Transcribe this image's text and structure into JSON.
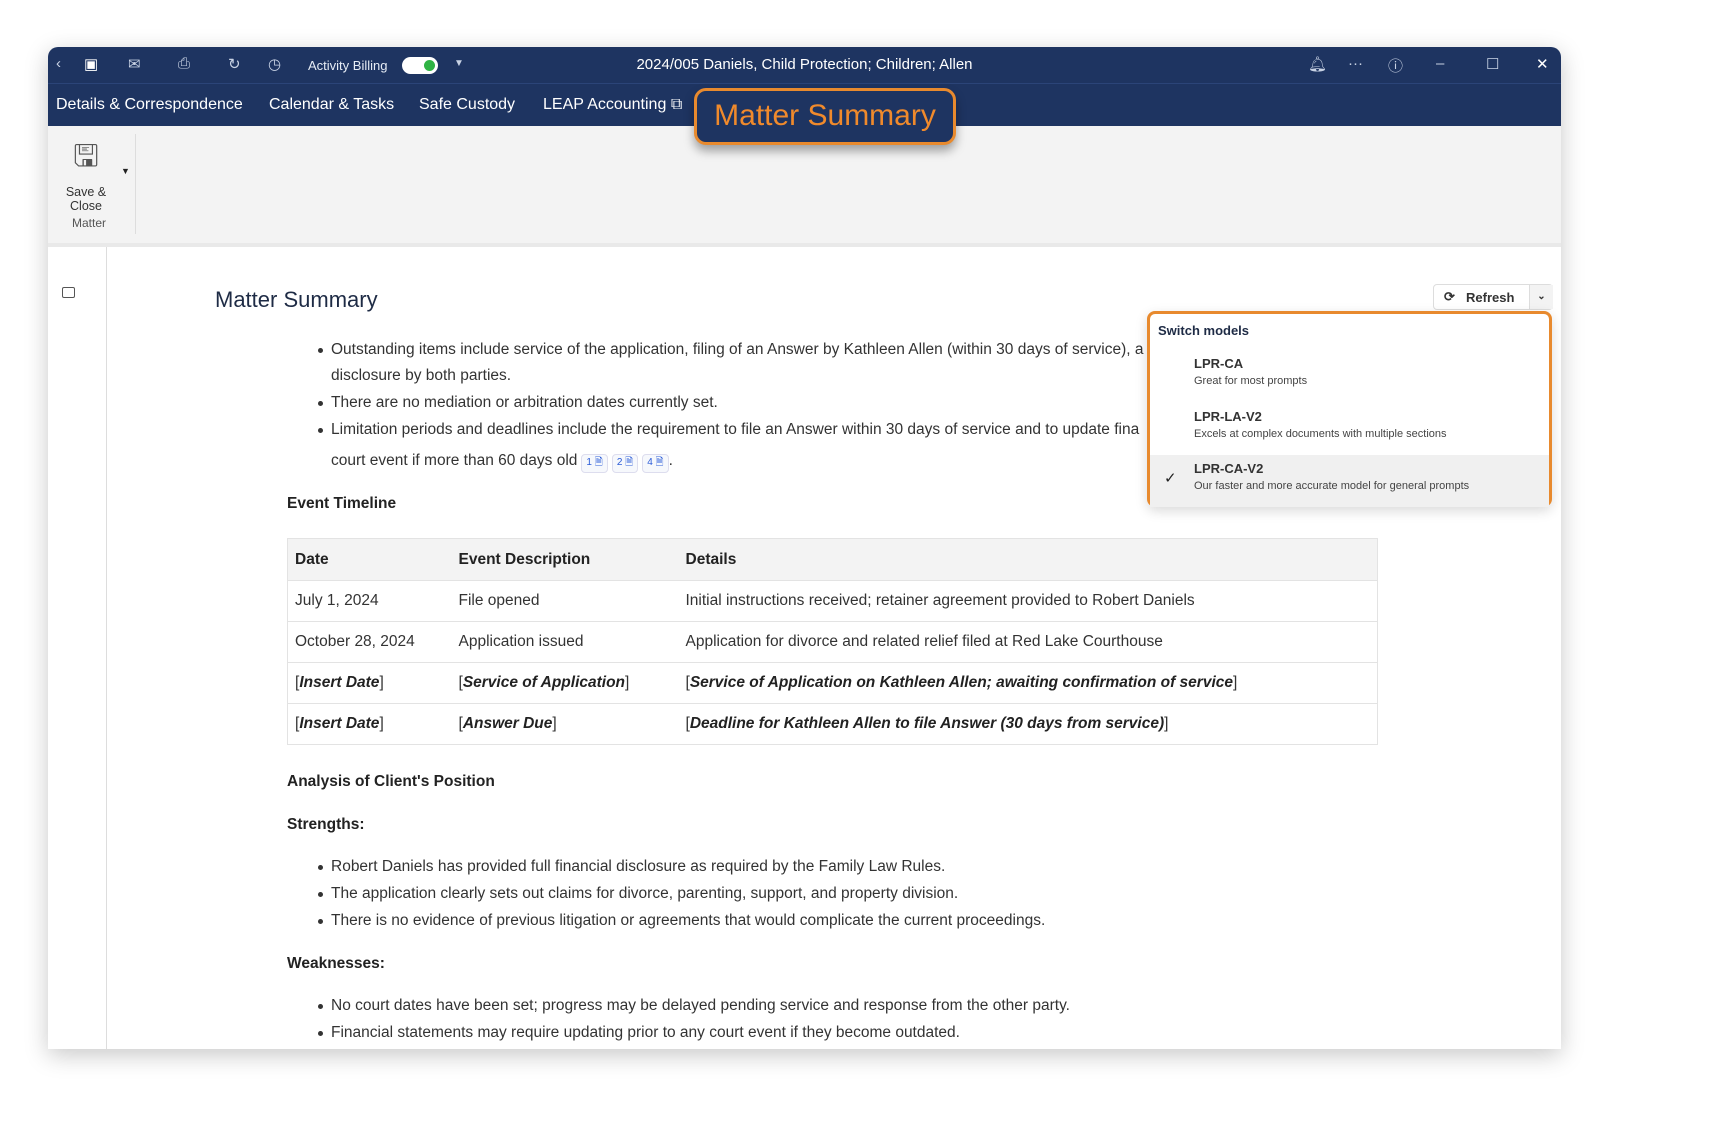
{
  "titlebar": {
    "activity_label": "Activity Billing",
    "title": "2024/005 Daniels, Child Protection; Children; Allen"
  },
  "tabs": [
    "Details & Correspondence",
    "Calendar & Tasks",
    "Safe Custody",
    "LEAP Accounting",
    "Matter Summary"
  ],
  "ribbon": {
    "save_label": "Save &",
    "close_label": "Close",
    "group_label": "Matter"
  },
  "main": {
    "heading": "Matter Summary",
    "refresh_label": "Refresh",
    "bullets": [
      "Outstanding items include service of the application, filing of an Answer by Kathleen Allen (within 30 days of service), a",
      "disclosure by both parties.",
      "There are no mediation or arbitration dates currently set.",
      "Limitation periods and deadlines include the requirement to file an Answer within 30 days of service and to update fina",
      "court event if more than 60 days old"
    ],
    "citations": [
      "1",
      "2",
      "4"
    ],
    "timeline_heading": "Event Timeline",
    "table": {
      "headers": [
        "Date",
        "Event Description",
        "Details"
      ],
      "rows": [
        [
          "July 1, 2024",
          "File opened",
          "Initial instructions received; retainer agreement provided to Robert Daniels"
        ],
        [
          "October 28, 2024",
          "Application issued",
          "Application for divorce and related relief filed at Red Lake Courthouse"
        ],
        [
          "Insert Date",
          "Service of Application",
          "Service of Application on Kathleen Allen; awaiting confirmation of service"
        ],
        [
          "Insert Date",
          "Answer Due",
          "Deadline for Kathleen Allen to file Answer (30 days from service)"
        ]
      ]
    },
    "analysis_heading": "Analysis of Client's Position",
    "strengths_heading": "Strengths:",
    "strengths": [
      "Robert Daniels has provided full financial disclosure as required by the Family Law Rules.",
      "The application clearly sets out claims for divorce, parenting, support, and property division.",
      "There is no evidence of previous litigation or agreements that would complicate the current proceedings."
    ],
    "weaknesses_heading": "Weaknesses:",
    "weaknesses": [
      "No court dates have been set; progress may be delayed pending service and response from the other party.",
      "Financial statements may require updating prior to any court event if they become outdated."
    ]
  },
  "menu": {
    "title": "Switch models",
    "items": [
      {
        "name": "LPR-CA",
        "desc": "Great for most prompts"
      },
      {
        "name": "LPR-LA-V2",
        "desc": "Excels at complex documents with multiple sections"
      },
      {
        "name": "LPR-CA-V2",
        "desc": "Our faster and more accurate model for general prompts",
        "selected": true
      }
    ]
  },
  "colors": {
    "nav": "#1e3461",
    "accent": "#e88a2e",
    "toggle": "#2fb344"
  }
}
